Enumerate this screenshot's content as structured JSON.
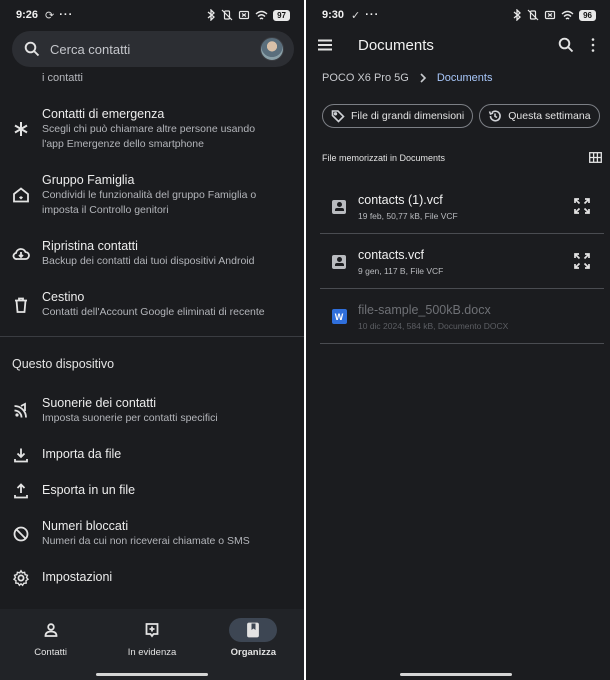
{
  "left": {
    "status": {
      "time": "9:26",
      "extra": "C",
      "battery": "97"
    },
    "search": {
      "placeholder": "Cerca contatti"
    },
    "truncated_subtitle": "i contatti",
    "items": [
      {
        "title": "Contatti di emergenza",
        "subtitle": "Scegli chi può chiamare altre persone usando l'app Emergenze dello smartphone",
        "icon": "asterisk-icon"
      },
      {
        "title": "Gruppo Famiglia",
        "subtitle": "Condividi le funzionalità del gruppo Famiglia o imposta il Controllo genitori",
        "icon": "family-home-icon"
      },
      {
        "title": "Ripristina contatti",
        "subtitle": "Backup dei contatti dai tuoi dispositivi Android",
        "icon": "cloud-download-icon"
      },
      {
        "title": "Cestino",
        "subtitle": "Contatti dell'Account Google eliminati di recente",
        "icon": "trash-icon"
      }
    ],
    "section_title": "Questo dispositivo",
    "device_items": [
      {
        "title": "Suonerie dei contatti",
        "subtitle": "Imposta suonerie per contatti specifici",
        "icon": "ringtone-icon"
      },
      {
        "title": "Importa da file",
        "subtitle": "",
        "icon": "download-icon"
      },
      {
        "title": "Esporta in un file",
        "subtitle": "",
        "icon": "upload-icon"
      },
      {
        "title": "Numeri bloccati",
        "subtitle": "Numeri da cui non riceverai chiamate o SMS",
        "icon": "block-icon"
      },
      {
        "title": "Impostazioni",
        "subtitle": "",
        "icon": "gear-icon"
      }
    ],
    "nav": [
      {
        "label": "Contatti",
        "icon": "person-icon"
      },
      {
        "label": "In evidenza",
        "icon": "highlight-icon"
      },
      {
        "label": "Organizza",
        "icon": "bookmark-icon"
      }
    ]
  },
  "right": {
    "status": {
      "time": "9:30",
      "extra": "✓",
      "battery": "96"
    },
    "title": "Documents",
    "breadcrumb": [
      "POCO X6 Pro 5G",
      "Documents"
    ],
    "chips": [
      {
        "label": "File di grandi dimensioni",
        "icon": "tag-icon"
      },
      {
        "label": "Questa settimana",
        "icon": "history-icon"
      }
    ],
    "list_header": "File memorizzati in Documents",
    "files": [
      {
        "name": "contacts (1).vcf",
        "meta": "19 feb, 50,77 kB, File VCF",
        "type": "vcf"
      },
      {
        "name": "contacts.vcf",
        "meta": "9 gen, 117 B, File VCF",
        "type": "vcf"
      },
      {
        "name": "file-sample_500kB.docx",
        "meta": "10 dic 2024, 584 kB, Documento DOCX",
        "type": "docx",
        "badge": "W"
      }
    ]
  }
}
